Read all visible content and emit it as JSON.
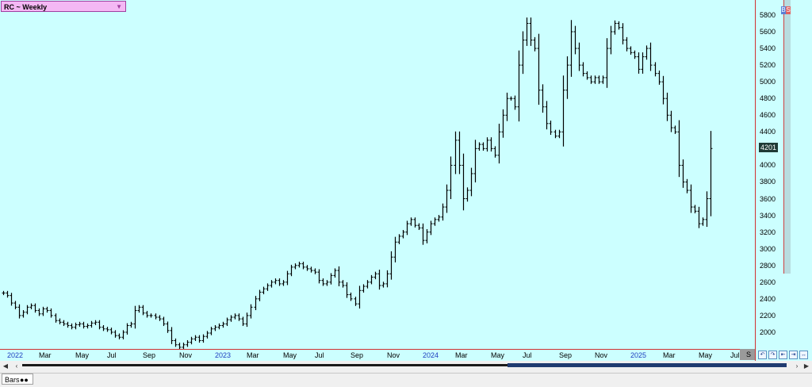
{
  "title": {
    "label": "RC ~ Weekly",
    "dropdown_icon": "triangle-down-icon"
  },
  "last_price": "4201",
  "badges": [
    "B",
    "S"
  ],
  "x_corner_label": "S",
  "tab": {
    "label": "Bars",
    "icon": "binoculars-icon"
  },
  "scroll": {
    "thumb_start_fraction": 0.63,
    "thumb_end_fraction": 1.0
  },
  "colors": {
    "plot_bg": "#ccffff",
    "bar": "#000000",
    "year_label": "#2040c0",
    "axis_line": "#d03030",
    "title_bg": "#f4b8f4"
  },
  "chart_data": {
    "type": "ohlc",
    "title": "RC ~ Weekly",
    "y_ticks": [
      2000,
      2200,
      2400,
      2600,
      2800,
      3000,
      3200,
      3400,
      3600,
      3800,
      4000,
      4200,
      4400,
      4600,
      4800,
      5000,
      5200,
      5400,
      5600,
      5800
    ],
    "ylim": [
      1800,
      5980
    ],
    "x_tick_labels": [
      {
        "label": "2022",
        "year": true
      },
      {
        "label": "Mar",
        "year": false
      },
      {
        "label": "May",
        "year": false
      },
      {
        "label": "Jul",
        "year": false
      },
      {
        "label": "Sep",
        "year": false
      },
      {
        "label": "Nov",
        "year": false
      },
      {
        "label": "2023",
        "year": true
      },
      {
        "label": "Mar",
        "year": false
      },
      {
        "label": "May",
        "year": false
      },
      {
        "label": "Jul",
        "year": false
      },
      {
        "label": "Sep",
        "year": false
      },
      {
        "label": "Nov",
        "year": false
      },
      {
        "label": "2024",
        "year": true
      },
      {
        "label": "Mar",
        "year": false
      },
      {
        "label": "May",
        "year": false
      },
      {
        "label": "Jul",
        "year": false
      },
      {
        "label": "Sep",
        "year": false
      },
      {
        "label": "Nov",
        "year": false
      },
      {
        "label": "2025",
        "year": true
      },
      {
        "label": "Mar",
        "year": false
      },
      {
        "label": "May",
        "year": false
      },
      {
        "label": "Jul",
        "year": false
      }
    ],
    "x_tick_index": [
      1,
      9,
      18,
      26,
      35,
      44,
      53,
      61,
      70,
      78,
      87,
      96,
      105,
      113,
      122,
      130,
      139,
      148,
      157,
      165,
      174,
      182
    ],
    "close": [
      2470,
      2440,
      2350,
      2300,
      2200,
      2240,
      2300,
      2320,
      2260,
      2220,
      2280,
      2260,
      2200,
      2140,
      2120,
      2100,
      2080,
      2060,
      2090,
      2100,
      2070,
      2080,
      2110,
      2120,
      2060,
      2040,
      2030,
      2000,
      1960,
      1940,
      2000,
      2080,
      2100,
      2260,
      2300,
      2230,
      2200,
      2200,
      2180,
      2160,
      2100,
      2020,
      1900,
      1850,
      1820,
      1850,
      1880,
      1920,
      1940,
      1900,
      1950,
      1990,
      2040,
      2060,
      2080,
      2100,
      2150,
      2180,
      2200,
      2160,
      2100,
      2200,
      2300,
      2400,
      2480,
      2520,
      2560,
      2600,
      2620,
      2580,
      2600,
      2700,
      2780,
      2800,
      2820,
      2780,
      2760,
      2740,
      2720,
      2620,
      2580,
      2600,
      2680,
      2740,
      2600,
      2560,
      2450,
      2400,
      2340,
      2500,
      2550,
      2600,
      2660,
      2700,
      2560,
      2580,
      2700,
      2900,
      3080,
      3150,
      3200,
      3300,
      3350,
      3280,
      3250,
      3100,
      3200,
      3300,
      3350,
      3380,
      3500,
      3700,
      4000,
      4300,
      4000,
      3600,
      3700,
      3900,
      4200,
      4250,
      4200,
      4300,
      4200,
      4120,
      4400,
      4600,
      4800,
      4800,
      4700,
      5200,
      5500,
      5700,
      5500,
      5400,
      4900,
      4700,
      4500,
      4400,
      4350,
      4400,
      4900,
      5200,
      5600,
      5400,
      5200,
      5100,
      5050,
      5000,
      5050,
      5000,
      5050,
      5400,
      5600,
      5700,
      5650,
      5500,
      5400,
      5350,
      5300,
      5150,
      5300,
      5400,
      5200,
      5100,
      5000,
      4800,
      4600,
      4450,
      4400,
      4000,
      3800,
      3700,
      3500,
      3450,
      3300,
      3350,
      3600,
      4201
    ],
    "note": "weekly OHLC bars; values read approximately from the price axis"
  }
}
